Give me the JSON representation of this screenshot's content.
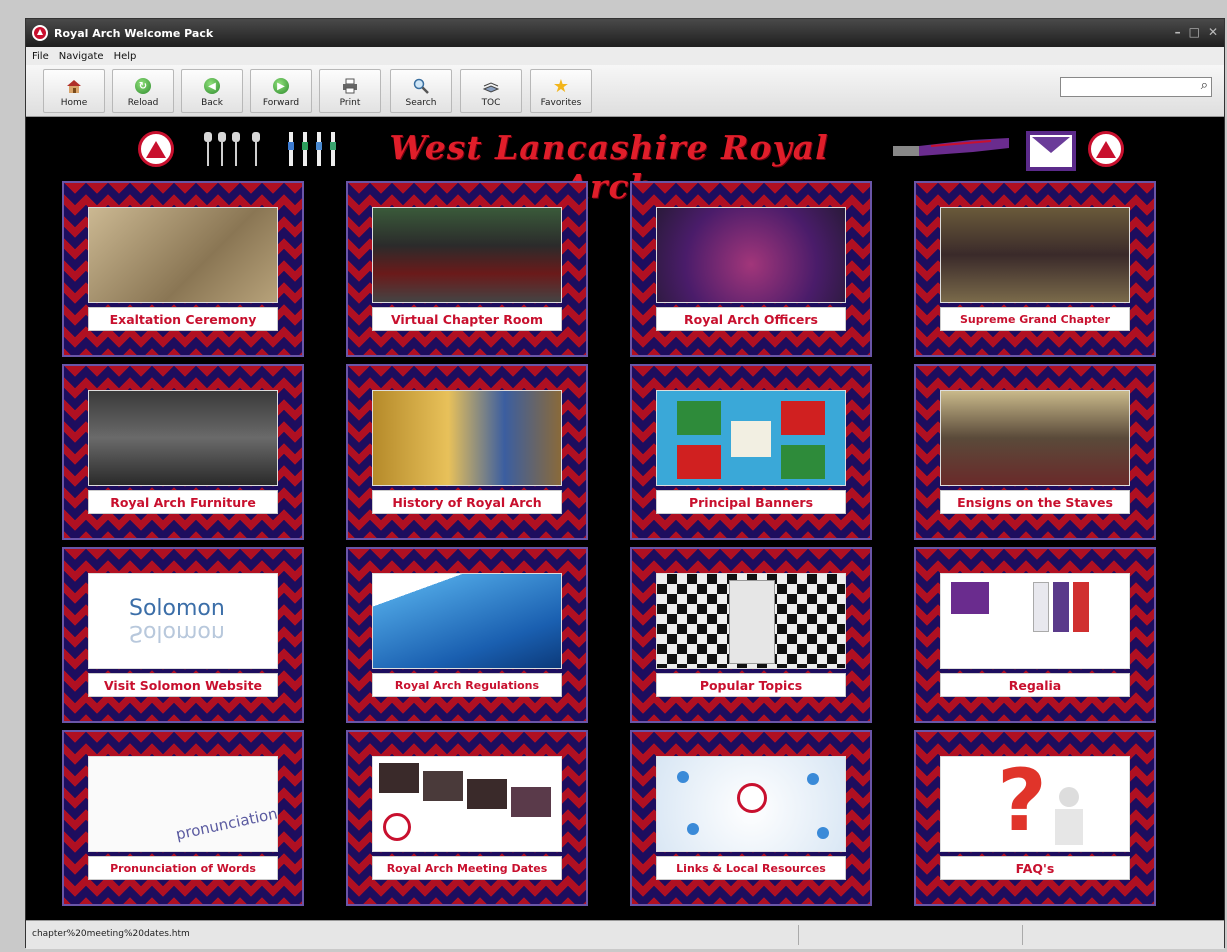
{
  "window": {
    "title": "Royal Arch Welcome Pack",
    "controls": [
      "–",
      "□",
      "✕"
    ]
  },
  "menu": {
    "items": [
      "File",
      "Navigate",
      "Help"
    ]
  },
  "toolbar": {
    "buttons": [
      {
        "label": "Home",
        "icon": "home-icon"
      },
      {
        "label": "Reload",
        "icon": "reload-icon"
      },
      {
        "label": "Back",
        "icon": "back-arrow-icon"
      },
      {
        "label": "Forward",
        "icon": "forward-arrow-icon"
      },
      {
        "label": "Print",
        "icon": "printer-icon"
      },
      {
        "label": "Search",
        "icon": "magnifier-icon"
      },
      {
        "label": "TOC",
        "icon": "book-icon"
      },
      {
        "label": "Favorites",
        "icon": "star-icon"
      }
    ],
    "search": {
      "value": "",
      "icon": "search-icon"
    }
  },
  "banner": {
    "title": "West Lancashire Royal Arch"
  },
  "tiles": [
    {
      "label": "Exaltation Ceremony"
    },
    {
      "label": "Virtual Chapter Room"
    },
    {
      "label": "Royal Arch Officers"
    },
    {
      "label": "Supreme Grand Chapter"
    },
    {
      "label": "Royal Arch Furniture"
    },
    {
      "label": "History of Royal Arch"
    },
    {
      "label": "Principal Banners"
    },
    {
      "label": "Ensigns on the Staves"
    },
    {
      "label": "Visit Solomon Website",
      "image_text": "Solomon"
    },
    {
      "label": "Royal Arch Regulations"
    },
    {
      "label": "Popular Topics"
    },
    {
      "label": "Regalia"
    },
    {
      "label": "Pronunciation of Words",
      "image_text": "pronunciation"
    },
    {
      "label": "Royal Arch Meeting Dates"
    },
    {
      "label": "Links & Local Resources"
    },
    {
      "label": "FAQ's"
    }
  ],
  "status": {
    "text": "chapter%20meeting%20dates.htm"
  },
  "colors": {
    "accent_red": "#c8102e",
    "tile_purple": "#1d0d5e",
    "tile_red": "#b01022",
    "background": "#000000"
  }
}
